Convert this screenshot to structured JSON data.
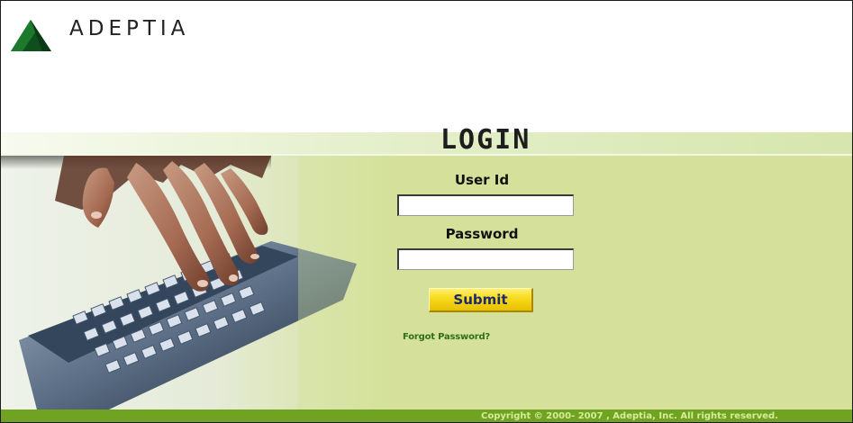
{
  "header": {
    "brand_name": "ADEPTIA",
    "logo_icon": "adeptia-triangle-logo-icon"
  },
  "login": {
    "title": "LOGIN",
    "user_id_label": "User Id",
    "user_id_value": "",
    "password_label": "Password",
    "password_value": "",
    "submit_label": "Submit",
    "forgot_password_label": "Forgot Password?"
  },
  "hero": {
    "image_icon": "keyboard-hand-photo"
  },
  "footer": {
    "copyright": "Copyright © 2000- 2007 , Adeptia, Inc. All rights reserved."
  },
  "colors": {
    "brand_green": "#6fa321",
    "panel_green": "#d5e19a",
    "button_yellow": "#f7da1c",
    "link_green": "#2f6f1a"
  }
}
